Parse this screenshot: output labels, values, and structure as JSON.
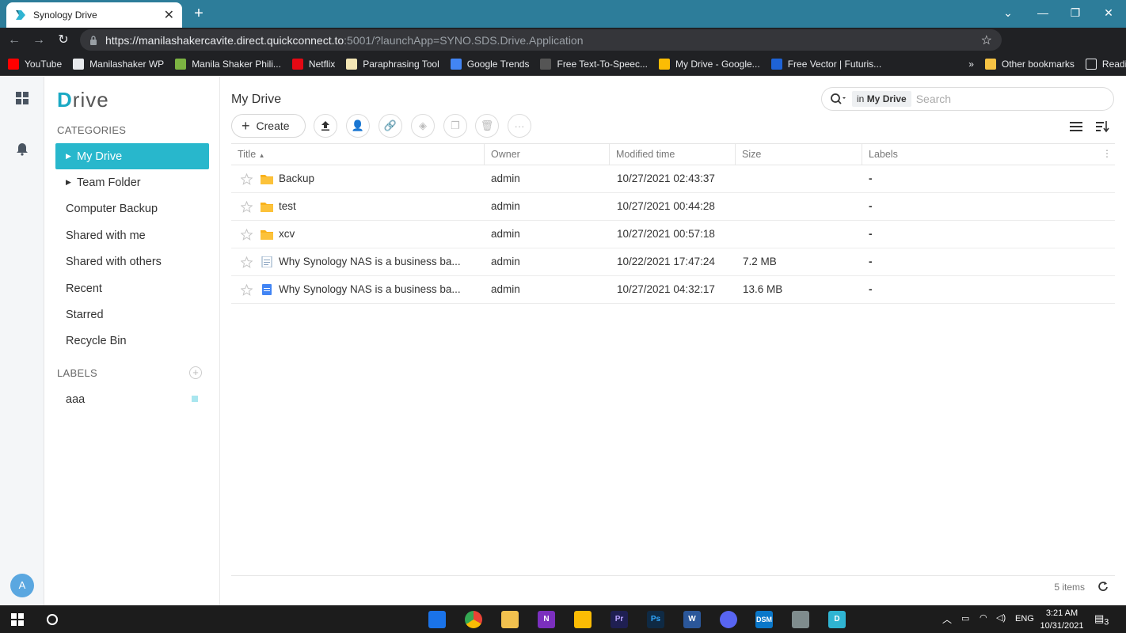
{
  "browser": {
    "tab_title": "Synology Drive",
    "url_host": "https://manilashakercavite.direct.quickconnect.to",
    "url_rest": ":5001/?launchApp=SYNO.SDS.Drive.Application",
    "bookmarks": [
      {
        "label": "YouTube",
        "color": "#ff0000"
      },
      {
        "label": "Manilashaker WP",
        "color": "#e8eaed"
      },
      {
        "label": "Manila Shaker Phili...",
        "color": "#7cb342"
      },
      {
        "label": "Netflix",
        "color": "#e50914"
      },
      {
        "label": "Paraphrasing Tool",
        "color": "#f3e6b5"
      },
      {
        "label": "Google Trends",
        "color": "#4285f4"
      },
      {
        "label": "Free Text-To-Speec...",
        "color": "#555555"
      },
      {
        "label": "My Drive - Google...",
        "color": "#fbbc04"
      },
      {
        "label": "Free Vector | Futuris...",
        "color": "#1e63d6"
      }
    ],
    "more_bookmarks": "»",
    "other_bookmarks": "Other bookmarks",
    "reading_list": "Reading list"
  },
  "app": {
    "logo_first": "D",
    "logo_rest": "rive",
    "categories_label": "CATEGORIES",
    "nav": [
      {
        "label": "My Drive",
        "caret": "▶"
      },
      {
        "label": "Team Folder",
        "caret": "▶"
      },
      {
        "label": "Computer Backup"
      },
      {
        "label": "Shared with me"
      },
      {
        "label": "Shared with others"
      },
      {
        "label": "Recent"
      },
      {
        "label": "Starred"
      },
      {
        "label": "Recycle Bin"
      }
    ],
    "labels_label": "LABELS",
    "labels": [
      {
        "label": "aaa",
        "color": "#a9e6ef"
      }
    ],
    "avatar": "A",
    "accent": "#28b7cc"
  },
  "main": {
    "title": "My Drive",
    "search_scope_prefix": "in",
    "search_scope": "My Drive",
    "search_placeholder": "Search",
    "create_label": "Create",
    "columns": [
      "Title",
      "Owner",
      "Modified time",
      "Size",
      "Labels"
    ],
    "sort_indicator": "▲",
    "rows": [
      {
        "name": "Backup",
        "type": "folder",
        "owner": "admin",
        "modified": "10/27/2021 02:43:37",
        "size": "",
        "labels": "-"
      },
      {
        "name": "test",
        "type": "folder",
        "owner": "admin",
        "modified": "10/27/2021 00:44:28",
        "size": "",
        "labels": "-"
      },
      {
        "name": "xcv",
        "type": "folder",
        "owner": "admin",
        "modified": "10/27/2021 00:57:18",
        "size": "",
        "labels": "-"
      },
      {
        "name": "Why Synology NAS is a business ba...",
        "type": "doc",
        "owner": "admin",
        "modified": "10/22/2021 17:47:24",
        "size": "7.2 MB",
        "labels": "-"
      },
      {
        "name": "Why Synology NAS is a business ba...",
        "type": "gdoc",
        "owner": "admin",
        "modified": "10/27/2021 04:32:17",
        "size": "13.6 MB",
        "labels": "-"
      }
    ],
    "item_count": "5 items"
  },
  "taskbar": {
    "lang": "ENG",
    "time": "3:21 AM",
    "date": "10/31/2021",
    "notif_count": "3"
  }
}
